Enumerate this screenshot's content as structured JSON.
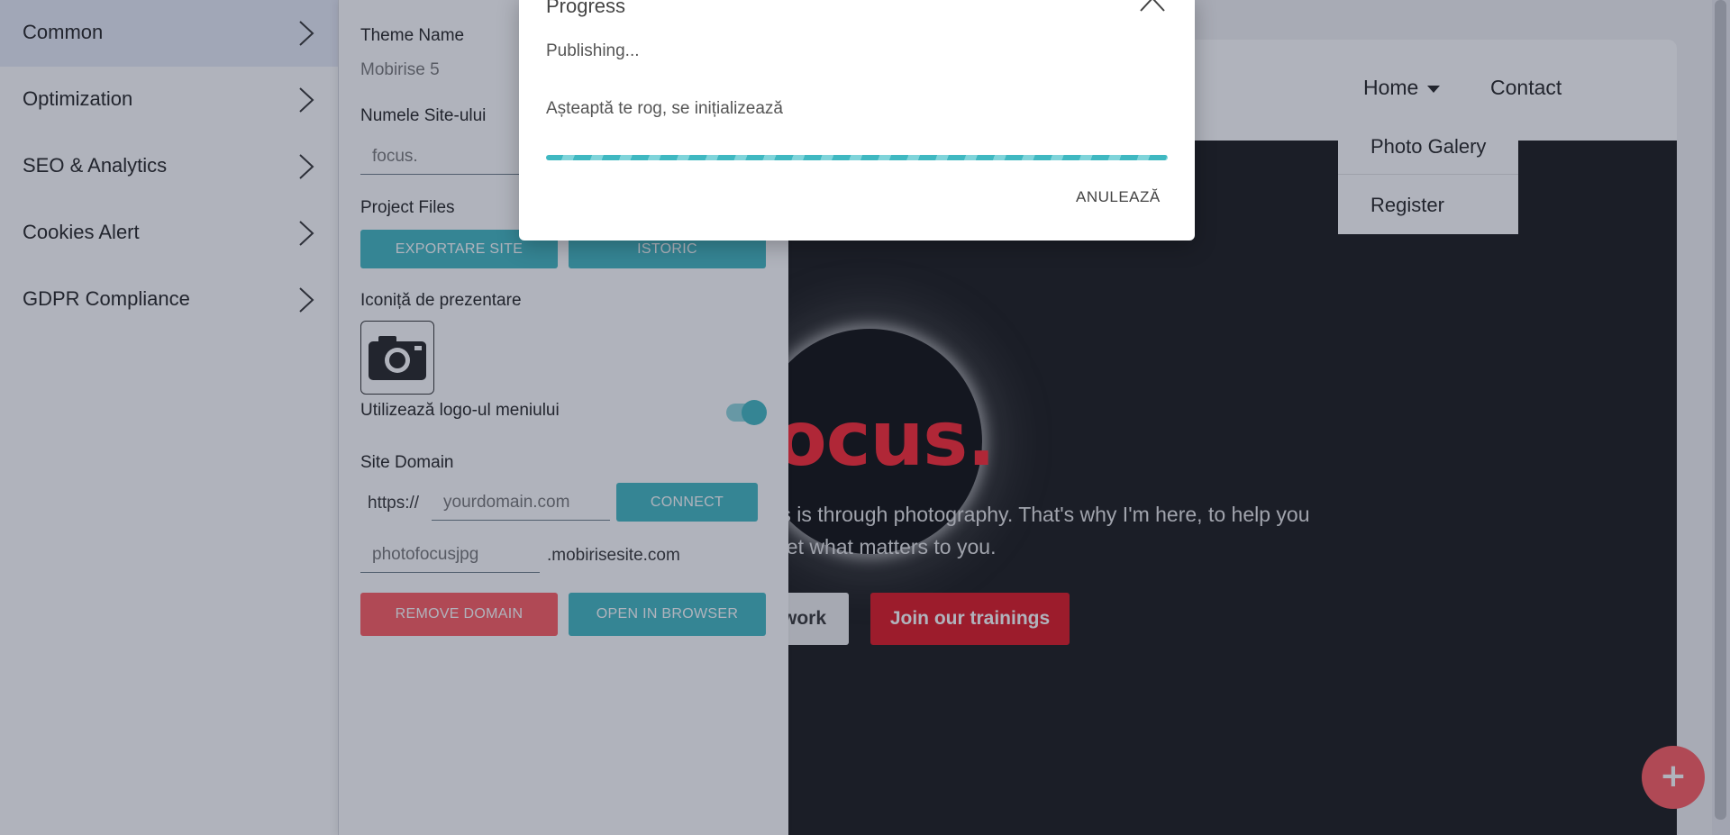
{
  "preview": {
    "nav": {
      "home_label": "Home",
      "contact_label": "Contact",
      "dropdown_items": [
        "Photo Galery",
        "Register"
      ]
    },
    "hero": {
      "title": "ocus.",
      "line1": "ts is through photography. That's why I'm here, to help you",
      "line2": "get what matters to you.",
      "secondary_button": "work",
      "primary_button": "Join our trainings"
    },
    "fab_label": "+",
    "colors": {
      "accent_red": "#e0141e",
      "hero_bg": "#161616"
    }
  },
  "sidebar": {
    "items": [
      {
        "label": "Common",
        "active": true
      },
      {
        "label": "Optimization",
        "active": false
      },
      {
        "label": "SEO & Analytics",
        "active": false
      },
      {
        "label": "Cookies Alert",
        "active": false
      },
      {
        "label": "GDPR Compliance",
        "active": false
      }
    ]
  },
  "panel": {
    "theme_name_label": "Theme Name",
    "theme_name_value": "Mobirise 5",
    "site_name_label": "Numele Site-ului",
    "site_name_value": "focus.",
    "project_files_label": "Project Files",
    "export_button": "EXPORTARE SITE",
    "history_button": "ISTORIC",
    "favicon_label": "Iconiță de prezentare",
    "favicon_icon": "camera-icon",
    "use_menu_logo_label": "Utilizează logo-ul meniului",
    "use_menu_logo_on": true,
    "site_domain_label": "Site Domain",
    "https_prefix": "https://",
    "domain_placeholder": "yourdomain.com",
    "connect_button": "CONNECT",
    "subdomain_placeholder": "photofocusjpg",
    "subdomain_suffix": ".mobirisesite.com",
    "remove_domain_button": "REMOVE DOMAIN",
    "open_browser_button": "OPEN IN BROWSER",
    "colors": {
      "teal": "#3fb8c1",
      "red": "#ff5a5f"
    }
  },
  "modal": {
    "title": "Progress",
    "status": "Publishing...",
    "message": "Așteaptă te rog, se inițializează",
    "cancel_button": "ANULEAZĂ"
  }
}
